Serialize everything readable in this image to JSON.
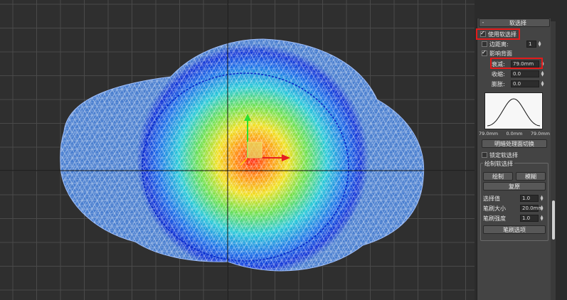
{
  "rollout": {
    "toggle": "-",
    "title": "软选择"
  },
  "options": {
    "use_soft_selection": "使用软选择",
    "edge_distance": "边距离:",
    "edge_distance_value": "1",
    "affect_backfacing": "影响背面"
  },
  "params": {
    "falloff_label": "衰减:",
    "falloff_value": "79.0mm",
    "pinch_label": "收缩:",
    "pinch_value": "0.0",
    "bubble_label": "膨胀:",
    "bubble_value": "0.0"
  },
  "curve_labels": {
    "left": "79.0mm",
    "center": "0.0mm",
    "right": "79.0mm"
  },
  "buttons": {
    "shaded_face_toggle": "明暗处理面切换",
    "lock_soft_selection": "锁定软选择",
    "paint_group_title": "绘制软选择",
    "paint": "绘制",
    "blur": "模糊",
    "revert": "复原",
    "brush_options": "笔刷选项"
  },
  "paint": {
    "selection_value_label": "选择值",
    "selection_value": "1.0",
    "brush_size_label": "笔刷大小",
    "brush_size": "20.0mm",
    "brush_strength_label": "笔刷强度",
    "brush_strength": "1.0"
  },
  "colors": {
    "highlight": "#e31b1b",
    "mesh_base": "#4a7fd0",
    "viewport_bg": "#2f2f2f"
  }
}
